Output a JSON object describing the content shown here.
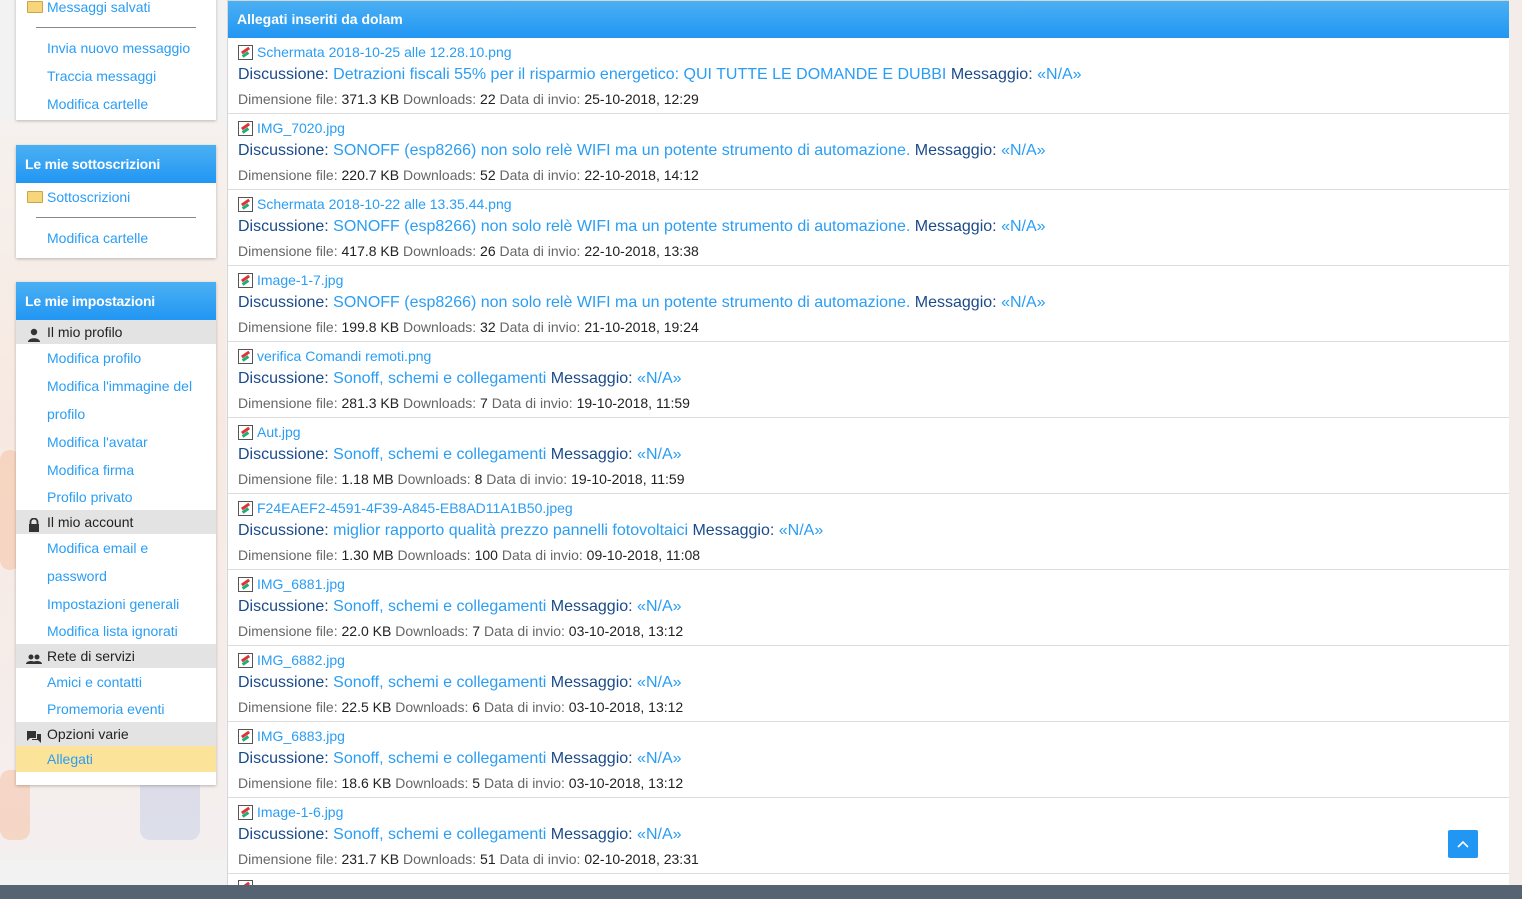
{
  "sidebar": {
    "messages": {
      "saved_label": "Messaggi salvati",
      "links": [
        "Invia nuovo messaggio",
        "Traccia messaggi",
        "Modifica cartelle"
      ]
    },
    "subscriptions": {
      "title": "Le mie sottoscrizioni",
      "folder_label": "Sottoscrizioni",
      "links": [
        "Modifica cartelle"
      ]
    },
    "settings": {
      "title": "Le mie impostazioni",
      "profile_section": "Il mio profilo",
      "profile_links": [
        "Modifica profilo",
        "Modifica l'immagine del profilo",
        "Modifica l'avatar",
        "Modifica firma",
        "Profilo privato"
      ],
      "account_section": "Il mio account",
      "account_links": [
        "Modifica email e password",
        "Impostazioni generali",
        "Modifica lista ignorati"
      ],
      "network_section": "Rete di servizi",
      "network_links": [
        "Amici e contatti",
        "Promemoria eventi"
      ],
      "misc_section": "Opzioni varie",
      "misc_links": [
        "Allegati"
      ]
    }
  },
  "main": {
    "title": "Allegati inseriti da dolam",
    "labels": {
      "discussion": "Discussione:",
      "message": "Messaggio:",
      "size": "Dimensione file:",
      "downloads": "Downloads:",
      "date": "Data di invio:"
    },
    "attachments": [
      {
        "file": "Schermata 2018-10-25 alle 12.28.10.png",
        "thread": "Detrazioni fiscali 55% per il risparmio energetico: QUI TUTTE LE DOMANDE E DUBBI",
        "message": "«N/A»",
        "size": "371.3 KB",
        "downloads": "22",
        "date": "25-10-2018, 12:29"
      },
      {
        "file": "IMG_7020.jpg",
        "thread": "SONOFF (esp8266) non solo relè WIFI ma un potente strumento di automazione.",
        "message": "«N/A»",
        "size": "220.7 KB",
        "downloads": "52",
        "date": "22-10-2018, 14:12"
      },
      {
        "file": "Schermata 2018-10-22 alle 13.35.44.png",
        "thread": "SONOFF (esp8266) non solo relè WIFI ma un potente strumento di automazione.",
        "message": "«N/A»",
        "size": "417.8 KB",
        "downloads": "26",
        "date": "22-10-2018, 13:38"
      },
      {
        "file": "Image-1-7.jpg",
        "thread": "SONOFF (esp8266) non solo relè WIFI ma un potente strumento di automazione.",
        "message": "«N/A»",
        "size": "199.8 KB",
        "downloads": "32",
        "date": "21-10-2018, 19:24"
      },
      {
        "file": "verifica Comandi remoti.png",
        "thread": "Sonoff, schemi e collegamenti",
        "message": "«N/A»",
        "size": "281.3 KB",
        "downloads": "7",
        "date": "19-10-2018, 11:59"
      },
      {
        "file": "Aut.jpg",
        "thread": "Sonoff, schemi e collegamenti",
        "message": "«N/A»",
        "size": "1.18 MB",
        "downloads": "8",
        "date": "19-10-2018, 11:59"
      },
      {
        "file": "F24EAEF2-4591-4F39-A845-EB8AD11A1B50.jpeg",
        "thread": "miglior rapporto qualità prezzo pannelli fotovoltaici",
        "message": "«N/A»",
        "size": "1.30 MB",
        "downloads": "100",
        "date": "09-10-2018, 11:08"
      },
      {
        "file": "IMG_6881.jpg",
        "thread": "Sonoff, schemi e collegamenti",
        "message": "«N/A»",
        "size": "22.0 KB",
        "downloads": "7",
        "date": "03-10-2018, 13:12"
      },
      {
        "file": "IMG_6882.jpg",
        "thread": "Sonoff, schemi e collegamenti",
        "message": "«N/A»",
        "size": "22.5 KB",
        "downloads": "6",
        "date": "03-10-2018, 13:12"
      },
      {
        "file": "IMG_6883.jpg",
        "thread": "Sonoff, schemi e collegamenti",
        "message": "«N/A»",
        "size": "18.6 KB",
        "downloads": "5",
        "date": "03-10-2018, 13:12"
      },
      {
        "file": "Image-1-6.jpg",
        "thread": "Sonoff, schemi e collegamenti",
        "message": "«N/A»",
        "size": "231.7 KB",
        "downloads": "51",
        "date": "02-10-2018, 23:31"
      }
    ]
  },
  "scroll_top_icon": "chevron-up-icon",
  "colors": {
    "accent": "#2196f3",
    "link": "#2a9df4",
    "active": "#fbe39a"
  }
}
